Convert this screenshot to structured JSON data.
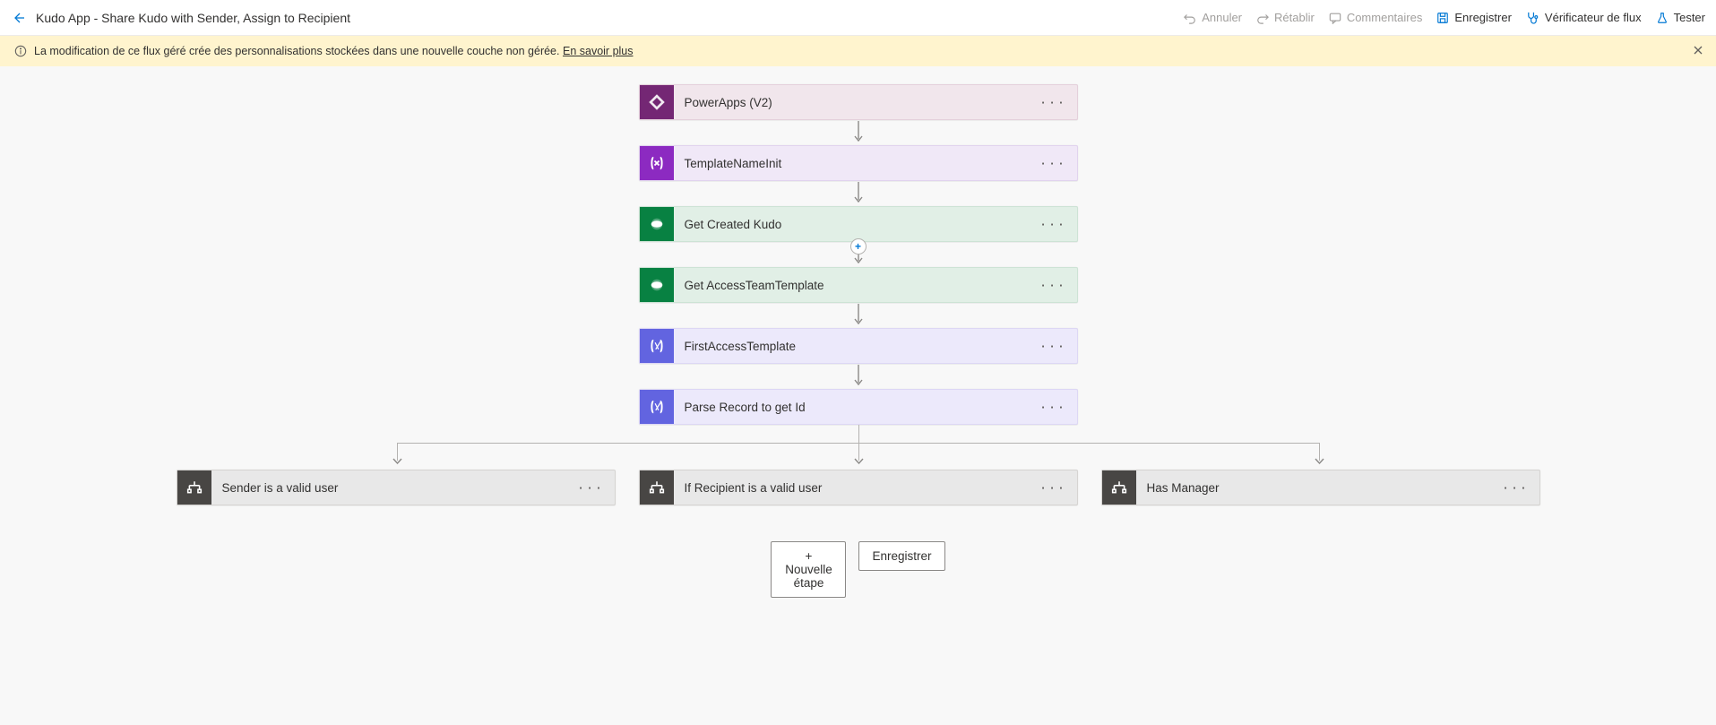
{
  "header": {
    "title": "Kudo App - Share Kudo with Sender, Assign to Recipient",
    "actions": {
      "undo": "Annuler",
      "redo": "Rétablir",
      "comments": "Commentaires",
      "save": "Enregistrer",
      "checker": "Vérificateur de flux",
      "test": "Tester"
    }
  },
  "banner": {
    "text": "La modification de ce flux géré crée des personnalisations stockées dans une nouvelle couche non gérée.",
    "link": "En savoir plus"
  },
  "steps": [
    {
      "kind": "powerapps",
      "label": "PowerApps (V2)"
    },
    {
      "kind": "variable",
      "label": "TemplateNameInit"
    },
    {
      "kind": "dataverse",
      "label": "Get Created Kudo"
    },
    {
      "kind": "dataverse",
      "label": "Get AccessTeamTemplate"
    },
    {
      "kind": "compose",
      "label": "FirstAccessTemplate"
    },
    {
      "kind": "compose",
      "label": "Parse Record to get Id"
    }
  ],
  "branches": [
    {
      "label": "Sender is a valid user"
    },
    {
      "label": "If Recipient is a valid user"
    },
    {
      "label": "Has Manager"
    }
  ],
  "footer": {
    "newStep": "+ Nouvelle étape",
    "save": "Enregistrer"
  },
  "icons": {
    "ellipsis": "· · ·"
  }
}
